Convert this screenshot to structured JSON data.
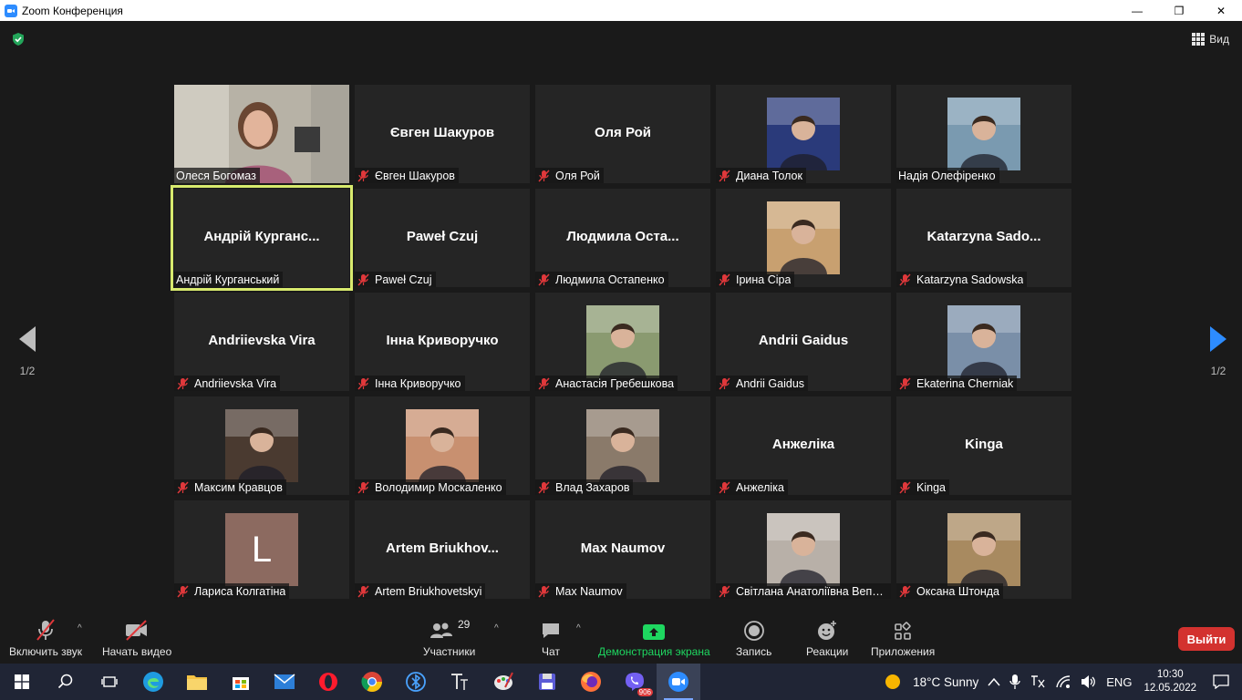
{
  "window": {
    "title": "Zoom Конференция",
    "controls": [
      "—",
      "❐",
      "✕"
    ]
  },
  "view_button": {
    "label": "Вид"
  },
  "pager": {
    "left": "1/2",
    "right": "1/2"
  },
  "tiles": [
    {
      "name": "Олеся Богомаз",
      "display": "",
      "kind": "video",
      "muted": false
    },
    {
      "name": "Євген Шакуров",
      "display": "Євген Шакуров",
      "kind": "name",
      "muted": true
    },
    {
      "name": "Оля Рой",
      "display": "Оля Рой",
      "kind": "name",
      "muted": true
    },
    {
      "name": "Диана Толок",
      "display": "",
      "kind": "photo",
      "muted": true,
      "color": "#2a3a7a"
    },
    {
      "name": "Надія Олефіренко",
      "display": "",
      "kind": "photo",
      "muted": false,
      "color": "#7a9ab0"
    },
    {
      "name": "Андрій Курганський",
      "display": "Андрій  Курганс...",
      "kind": "name",
      "muted": false,
      "active": true
    },
    {
      "name": "Paweł Czuj",
      "display": "Paweł Czuj",
      "kind": "name",
      "muted": true
    },
    {
      "name": "Людмила Остапенко",
      "display": "Людмила  Оста...",
      "kind": "name",
      "muted": true
    },
    {
      "name": "Ірина Сіра",
      "display": "",
      "kind": "photo",
      "muted": true,
      "color": "#c8a070"
    },
    {
      "name": "Katarzyna Sadowska",
      "display": "Katarzyna  Sado...",
      "kind": "name",
      "muted": true
    },
    {
      "name": "Andriievska Vira",
      "display": "Andriievska Vira",
      "kind": "name",
      "muted": true
    },
    {
      "name": "Інна Криворучко",
      "display": "Інна Криворучко",
      "kind": "name",
      "muted": true
    },
    {
      "name": "Анастасія Гребешкова",
      "display": "",
      "kind": "photo",
      "muted": true,
      "color": "#8a9a70"
    },
    {
      "name": "Andrii Gaidus",
      "display": "Andrii Gaidus",
      "kind": "name",
      "muted": true
    },
    {
      "name": "Ekaterina Cherniak",
      "display": "",
      "kind": "photo",
      "muted": true,
      "color": "#7a8fa8"
    },
    {
      "name": "Максим Кравцов",
      "display": "",
      "kind": "photo",
      "muted": true,
      "color": "#4a3a30"
    },
    {
      "name": "Володимир Москаленко",
      "display": "",
      "kind": "photo",
      "muted": true,
      "color": "#c89070"
    },
    {
      "name": "Влад Захаров",
      "display": "",
      "kind": "photo",
      "muted": true,
      "color": "#8a7a6a"
    },
    {
      "name": "Анжеліка",
      "display": "Анжеліка",
      "kind": "name",
      "muted": true
    },
    {
      "name": "Kinga",
      "display": "Kinga",
      "kind": "name",
      "muted": true
    },
    {
      "name": "Лариса Колгатіна",
      "display": "",
      "kind": "letter",
      "letter": "L",
      "muted": true
    },
    {
      "name": "Artem Briukhovetskyi",
      "display": "Artem  Briukhov...",
      "kind": "name",
      "muted": true
    },
    {
      "name": "Max Naumov",
      "display": "Max Naumov",
      "kind": "name",
      "muted": true
    },
    {
      "name": "Світлана Анатоліївна Вепр...",
      "display": "",
      "kind": "photo",
      "muted": true,
      "color": "#b8b0a8"
    },
    {
      "name": "Оксана Штонда",
      "display": "",
      "kind": "photo",
      "muted": true,
      "color": "#a88a60"
    }
  ],
  "toolbar": {
    "unmute": "Включить звук",
    "start_video": "Начать видео",
    "participants": "Участники",
    "participants_count": "29",
    "chat": "Чат",
    "share": "Демонстрация экрана",
    "record": "Запись",
    "reactions": "Реакции",
    "apps": "Приложения",
    "leave": "Выйти"
  },
  "taskbar": {
    "apps": [
      "start-icon",
      "search-icon",
      "task-view-icon",
      "edge-icon",
      "explorer-icon",
      "store-icon",
      "mail-icon",
      "opera-icon",
      "chrome-icon",
      "bluetooth-app-icon",
      "text-app-icon",
      "paint-icon",
      "save-app-icon",
      "firefox-icon",
      "viber-icon",
      "zoom-icon"
    ],
    "viber_badge": "906",
    "weather": "18°C  Sunny",
    "lang": "ENG",
    "time": "10:30",
    "date": "12.05.2022"
  },
  "colors": {
    "accent": "#2d8cff",
    "share_green": "#1ed760",
    "leave_red": "#d3322f",
    "muted_red": "#e0383b",
    "active_border": "#d8ea6e"
  }
}
